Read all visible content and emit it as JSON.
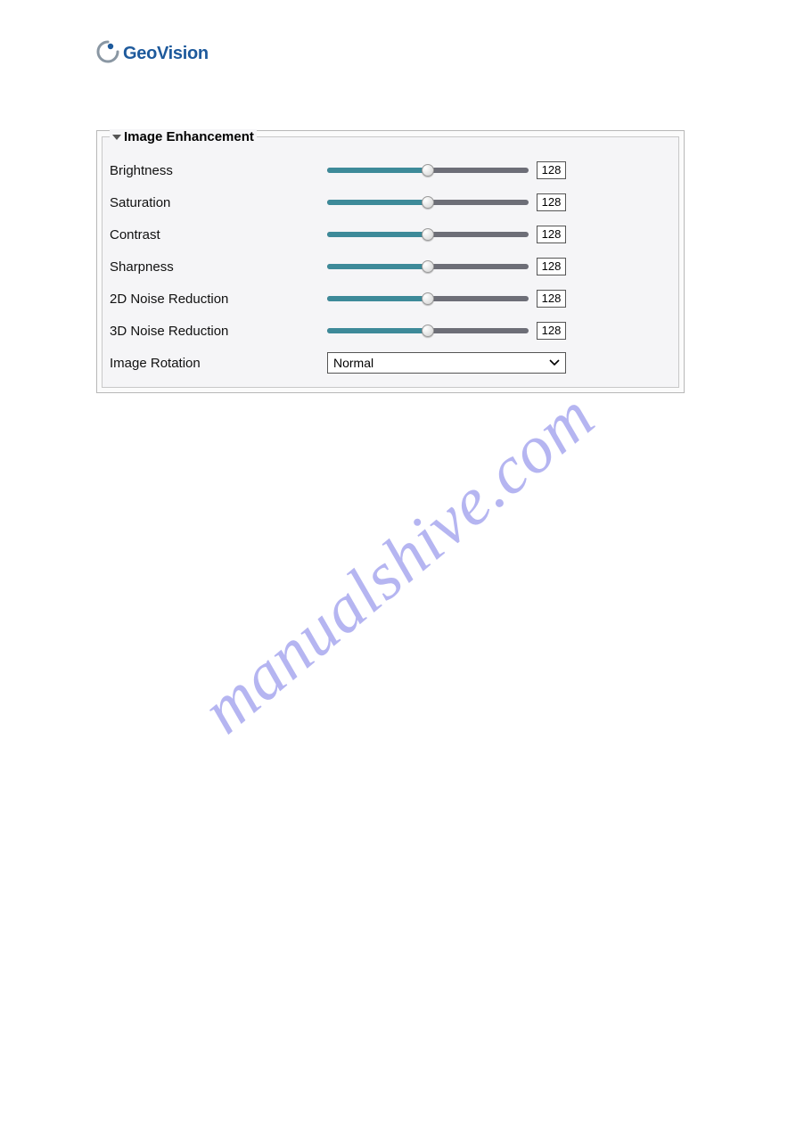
{
  "logo": {
    "brand_text": "GeoVision"
  },
  "panel": {
    "legend": "Image Enhancement",
    "sliders": [
      {
        "label": "Brightness",
        "value": "128"
      },
      {
        "label": "Saturation",
        "value": "128"
      },
      {
        "label": "Contrast",
        "value": "128"
      },
      {
        "label": "Sharpness",
        "value": "128"
      },
      {
        "label": "2D Noise Reduction",
        "value": "128"
      },
      {
        "label": "3D Noise Reduction",
        "value": "128"
      }
    ],
    "rotation": {
      "label": "Image Rotation",
      "selected": "Normal"
    }
  },
  "watermark": "manualshive.com"
}
